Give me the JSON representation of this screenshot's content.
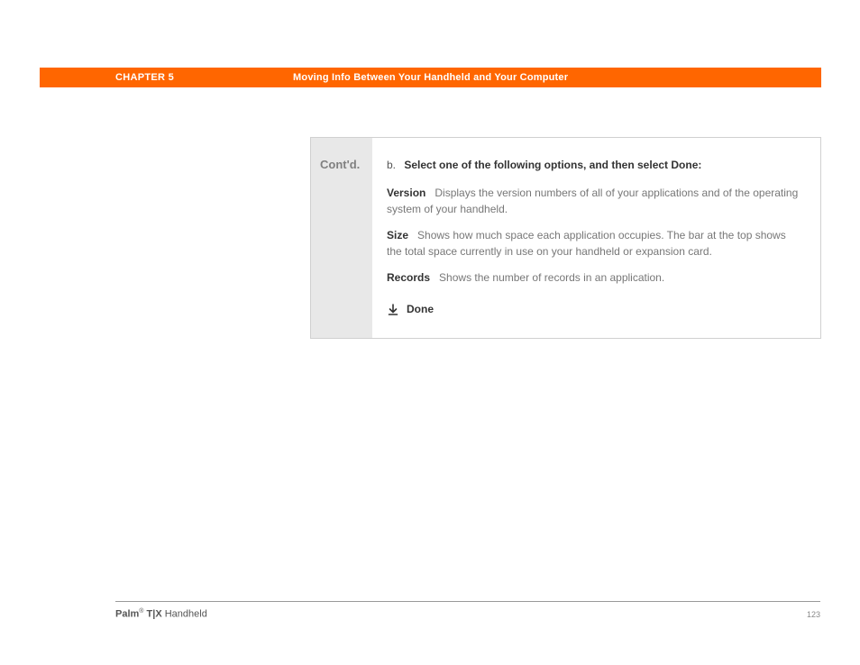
{
  "header": {
    "chapter_label": "CHAPTER 5",
    "chapter_title": "Moving Info Between Your Handheld and Your Computer"
  },
  "box": {
    "contd": "Cont'd.",
    "step_letter": "b.",
    "step_text": "Select one of the following options, and then select Done:",
    "options": [
      {
        "title": "Version",
        "desc": "Displays the version numbers of all of your applications and of the operating system of your handheld."
      },
      {
        "title": "Size",
        "desc": "Shows how much space each application occupies. The bar at the top shows the total space currently in use on your handheld or expansion card."
      },
      {
        "title": "Records",
        "desc": "Shows the number of records in an application."
      }
    ],
    "done": "Done"
  },
  "footer": {
    "brand": "Palm",
    "reg": "®",
    "model": " T|X",
    "suffix": " Handheld",
    "page": "123"
  }
}
